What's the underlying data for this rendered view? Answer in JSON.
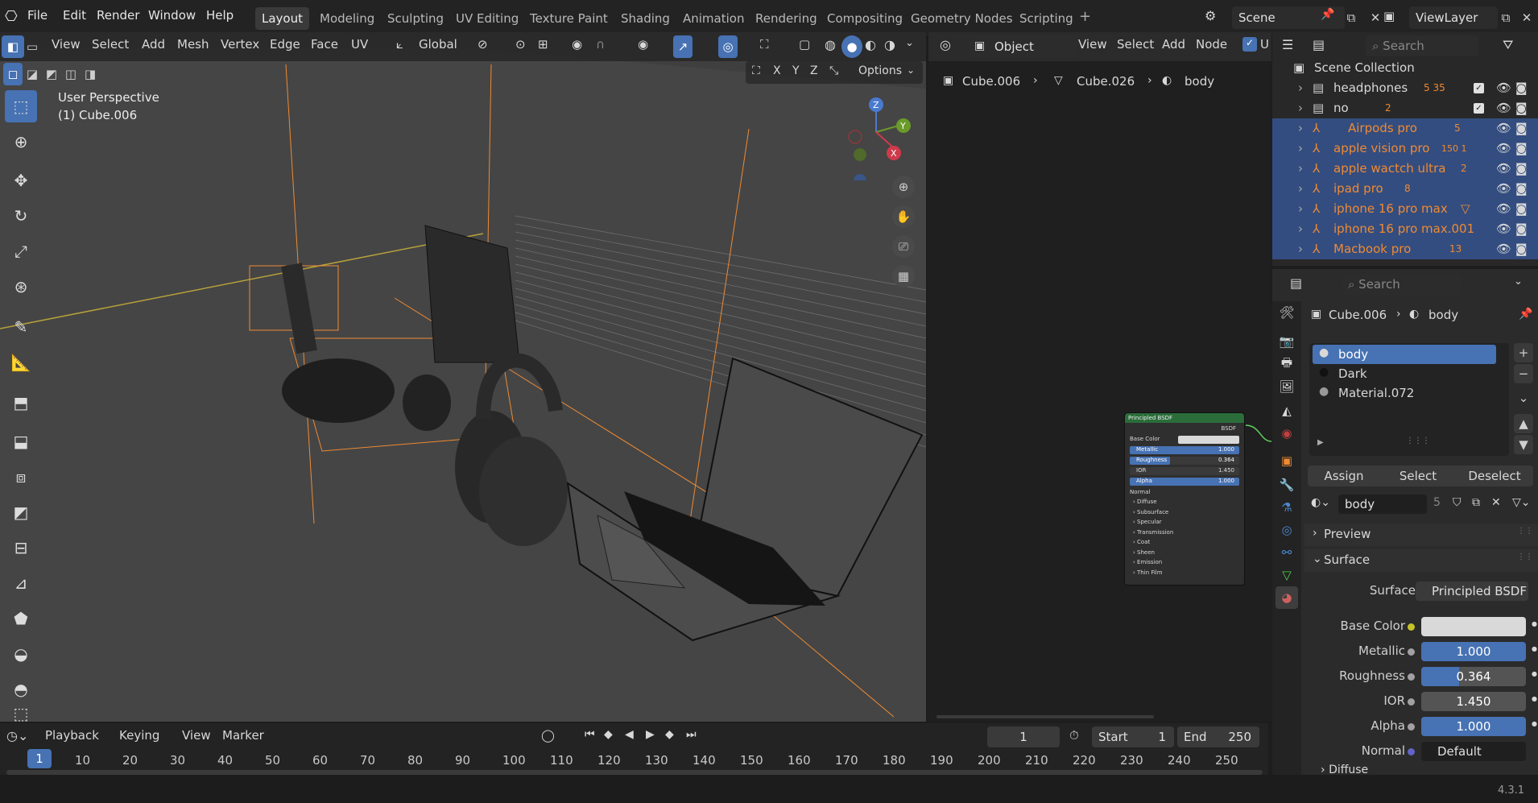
{
  "app": {
    "version": "4.3.1"
  },
  "menus": [
    "File",
    "Edit",
    "Render",
    "Window",
    "Help"
  ],
  "workspaces": [
    "Layout",
    "Modeling",
    "Sculpting",
    "UV Editing",
    "Texture Paint",
    "Shading",
    "Animation",
    "Rendering",
    "Compositing",
    "Geometry Nodes",
    "Scripting"
  ],
  "active_workspace": "Layout",
  "scene": {
    "label": "Scene",
    "view_layer": "ViewLayer"
  },
  "viewport": {
    "menus": [
      "View",
      "Select",
      "Add",
      "Mesh",
      "Vertex",
      "Edge",
      "Face",
      "UV"
    ],
    "orientation": "Global",
    "overlay_text_1": "User Perspective",
    "overlay_text_2": "(1) Cube.006",
    "options_label": "Options",
    "axes": [
      "X",
      "Y",
      "Z"
    ],
    "gizmo_axes": [
      "Z",
      "Y",
      "X"
    ]
  },
  "node_editor": {
    "mode": "Object",
    "menus": [
      "View",
      "Select",
      "Add",
      "Node"
    ],
    "toggle_label": "U",
    "breadcrumb": [
      "Cube.006",
      "Cube.026",
      "body"
    ],
    "node": {
      "title": "Principled BSDF",
      "output": "BSDF",
      "fields": [
        {
          "label": "Base Color",
          "value": ""
        },
        {
          "label": "Metallic",
          "value": "1.000"
        },
        {
          "label": "Roughness",
          "value": "0.364"
        },
        {
          "label": "IOR",
          "value": "1.450"
        },
        {
          "label": "Alpha",
          "value": "1.000"
        }
      ],
      "sockets": [
        "Normal"
      ],
      "panels": [
        "Diffuse",
        "Subsurface",
        "Specular",
        "Transmission",
        "Coat",
        "Sheen",
        "Emission",
        "Thin Film"
      ]
    }
  },
  "outliner": {
    "search_placeholder": "Search",
    "root": "Scene Collection",
    "items": [
      {
        "name": "headphones",
        "selected": false,
        "badge": "5 35"
      },
      {
        "name": "no",
        "selected": false,
        "badge": "2"
      },
      {
        "name": "Airpods pro",
        "selected": true,
        "badge": "5"
      },
      {
        "name": "apple vision pro",
        "selected": true,
        "badge": "150 1"
      },
      {
        "name": "apple wactch ultra",
        "selected": true,
        "badge": "2"
      },
      {
        "name": "ipad pro",
        "selected": true,
        "badge": "8"
      },
      {
        "name": "iphone 16 pro max",
        "selected": true,
        "badge": ""
      },
      {
        "name": "iphone 16 pro max.001",
        "selected": true,
        "badge": ""
      },
      {
        "name": "Macbook pro",
        "selected": true,
        "badge": "13"
      }
    ]
  },
  "properties": {
    "search_placeholder": "Search",
    "breadcrumb": [
      "Cube.006",
      "body"
    ],
    "slots": [
      "body",
      "Dark",
      "Material.072"
    ],
    "active_slot": "body",
    "buttons": [
      "Assign",
      "Select",
      "Deselect"
    ],
    "material_name": "body",
    "material_users": "5",
    "sections": {
      "preview": "Preview",
      "surface": "Surface",
      "diffuse": "Diffuse"
    },
    "surface_shader": {
      "label": "Surface",
      "value": "Principled BSDF"
    },
    "fields": [
      {
        "label": "Base Color",
        "value": "",
        "kind": "color",
        "dot": "#c7c229"
      },
      {
        "label": "Metallic",
        "value": "1.000",
        "kind": "blue",
        "dot": "#a1a1a1"
      },
      {
        "label": "Roughness",
        "value": "0.364",
        "kind": "blue",
        "fill": 0.364,
        "dot": "#a1a1a1"
      },
      {
        "label": "IOR",
        "value": "1.450",
        "kind": "dark",
        "dot": "#a1a1a1"
      },
      {
        "label": "Alpha",
        "value": "1.000",
        "kind": "blue",
        "dot": "#a1a1a1"
      },
      {
        "label": "Normal",
        "value": "Default",
        "kind": "dark",
        "dot": "#6363c7"
      }
    ]
  },
  "timeline": {
    "menus": [
      "Playback",
      "Keying",
      "View",
      "Marker"
    ],
    "current_frame": "1",
    "start_label": "Start",
    "start": "1",
    "end_label": "End",
    "end": "250",
    "ticks": [
      "1",
      "10",
      "20",
      "30",
      "40",
      "50",
      "60",
      "70",
      "80",
      "90",
      "100",
      "110",
      "120",
      "130",
      "140",
      "150",
      "160",
      "170",
      "180",
      "190",
      "200",
      "210",
      "220",
      "230",
      "240",
      "250"
    ]
  },
  "colors": {
    "accent": "#4772b3",
    "selection": "#334d80",
    "orange": "#ef8a33"
  }
}
